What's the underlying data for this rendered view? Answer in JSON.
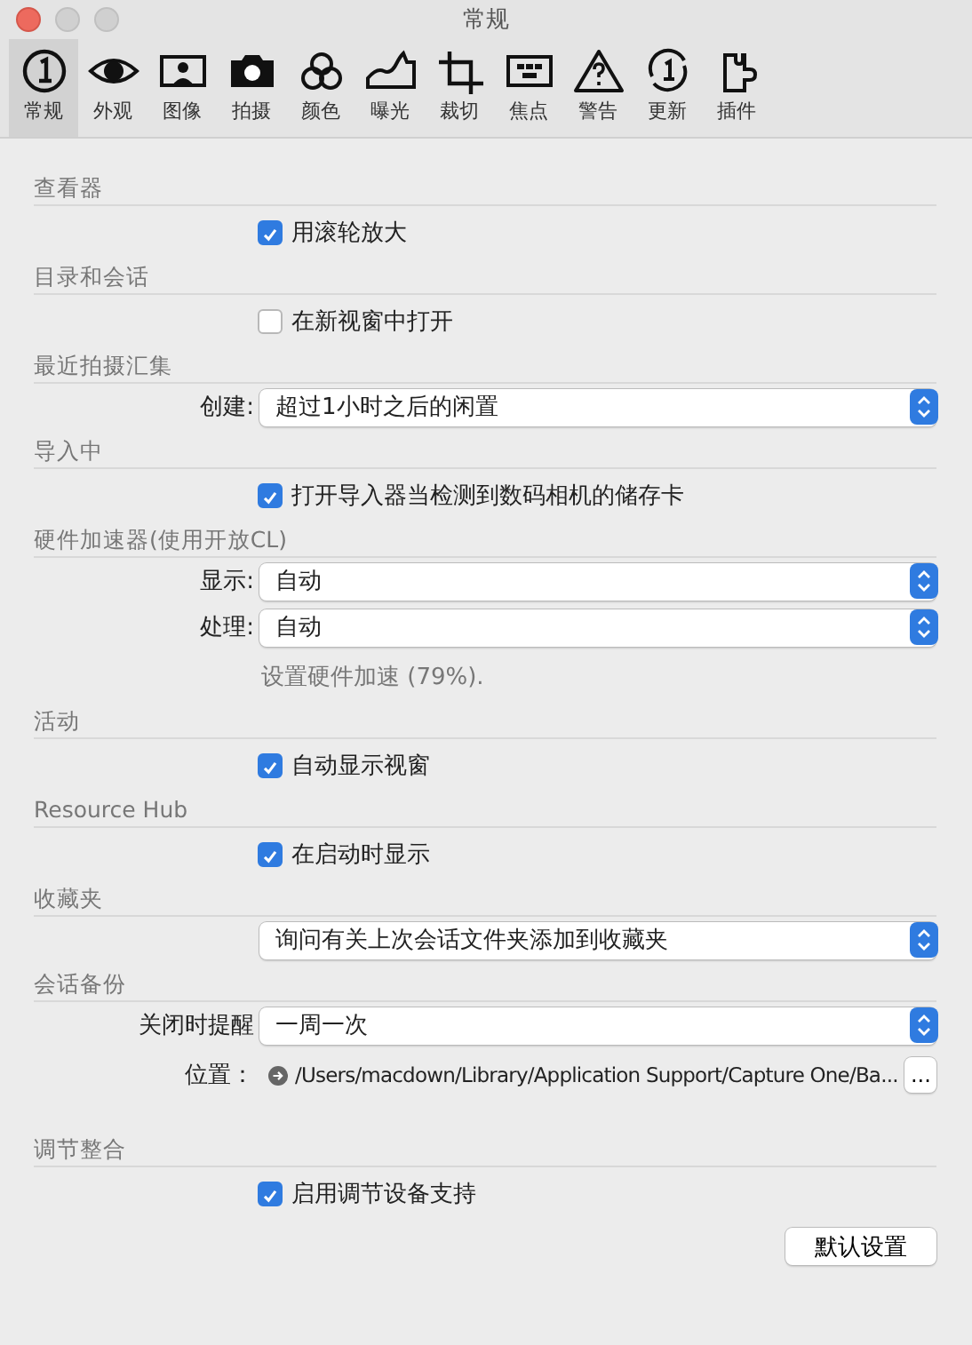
{
  "window": {
    "title": "常规"
  },
  "toolbar": [
    {
      "label": "常规",
      "selected": true,
      "kind": "general"
    },
    {
      "label": "外观",
      "selected": false,
      "kind": "eye"
    },
    {
      "label": "图像",
      "selected": false,
      "kind": "portrait"
    },
    {
      "label": "拍摄",
      "selected": false,
      "kind": "camera"
    },
    {
      "label": "颜色",
      "selected": false,
      "kind": "circles"
    },
    {
      "label": "曝光",
      "selected": false,
      "kind": "histogram"
    },
    {
      "label": "裁切",
      "selected": false,
      "kind": "crop"
    },
    {
      "label": "焦点",
      "selected": false,
      "kind": "focus"
    },
    {
      "label": "警告",
      "selected": false,
      "kind": "warning"
    },
    {
      "label": "更新",
      "selected": false,
      "kind": "update"
    },
    {
      "label": "插件",
      "selected": false,
      "kind": "puzzle"
    }
  ],
  "sections": [
    {
      "title": "查看器",
      "rows": [
        {
          "kind": "checkbox",
          "label": "用滚轮放大",
          "checked": true
        }
      ]
    },
    {
      "title": "目录和会话",
      "rows": [
        {
          "kind": "checkbox",
          "label": "在新视窗中打开",
          "checked": false
        }
      ]
    },
    {
      "title": "最近拍摄汇集",
      "rows": [
        {
          "kind": "select",
          "label": "创建:",
          "value": "超过1小时之后的闲置"
        }
      ]
    },
    {
      "title": "导入中",
      "rows": [
        {
          "kind": "checkbox",
          "label": "打开导入器当检测到数码相机的储存卡",
          "checked": true
        }
      ]
    },
    {
      "title": "硬件加速器(使用开放CL)",
      "rows": [
        {
          "kind": "select",
          "label": "显示:",
          "value": "自动"
        },
        {
          "kind": "select",
          "label": "处理:",
          "value": "自动"
        },
        {
          "kind": "note",
          "text": "设置硬件加速 (79%)."
        }
      ]
    },
    {
      "title": "活动",
      "rows": [
        {
          "kind": "checkbox",
          "label": "自动显示视窗",
          "checked": true
        }
      ]
    },
    {
      "title": "Resource Hub",
      "rows": [
        {
          "kind": "checkbox",
          "label": "在启动时显示",
          "checked": true
        }
      ]
    },
    {
      "title": "收藏夹",
      "rows": [
        {
          "kind": "select",
          "value": "询问有关上次会话文件夹添加到收藏夹"
        }
      ]
    },
    {
      "title": "会话备份",
      "rows": [
        {
          "kind": "select",
          "label": "关闭时提醒",
          "value": "一周一次"
        },
        {
          "kind": "path",
          "label": "位置：",
          "value": "/Users/macdown/Library/Application Support/Capture One/Ba...",
          "button": "..."
        }
      ]
    },
    {
      "title": "调节整合",
      "rows": [
        {
          "kind": "checkbox",
          "label": "启用调节设备支持",
          "checked": true
        }
      ]
    }
  ],
  "default_button": "默认设置"
}
